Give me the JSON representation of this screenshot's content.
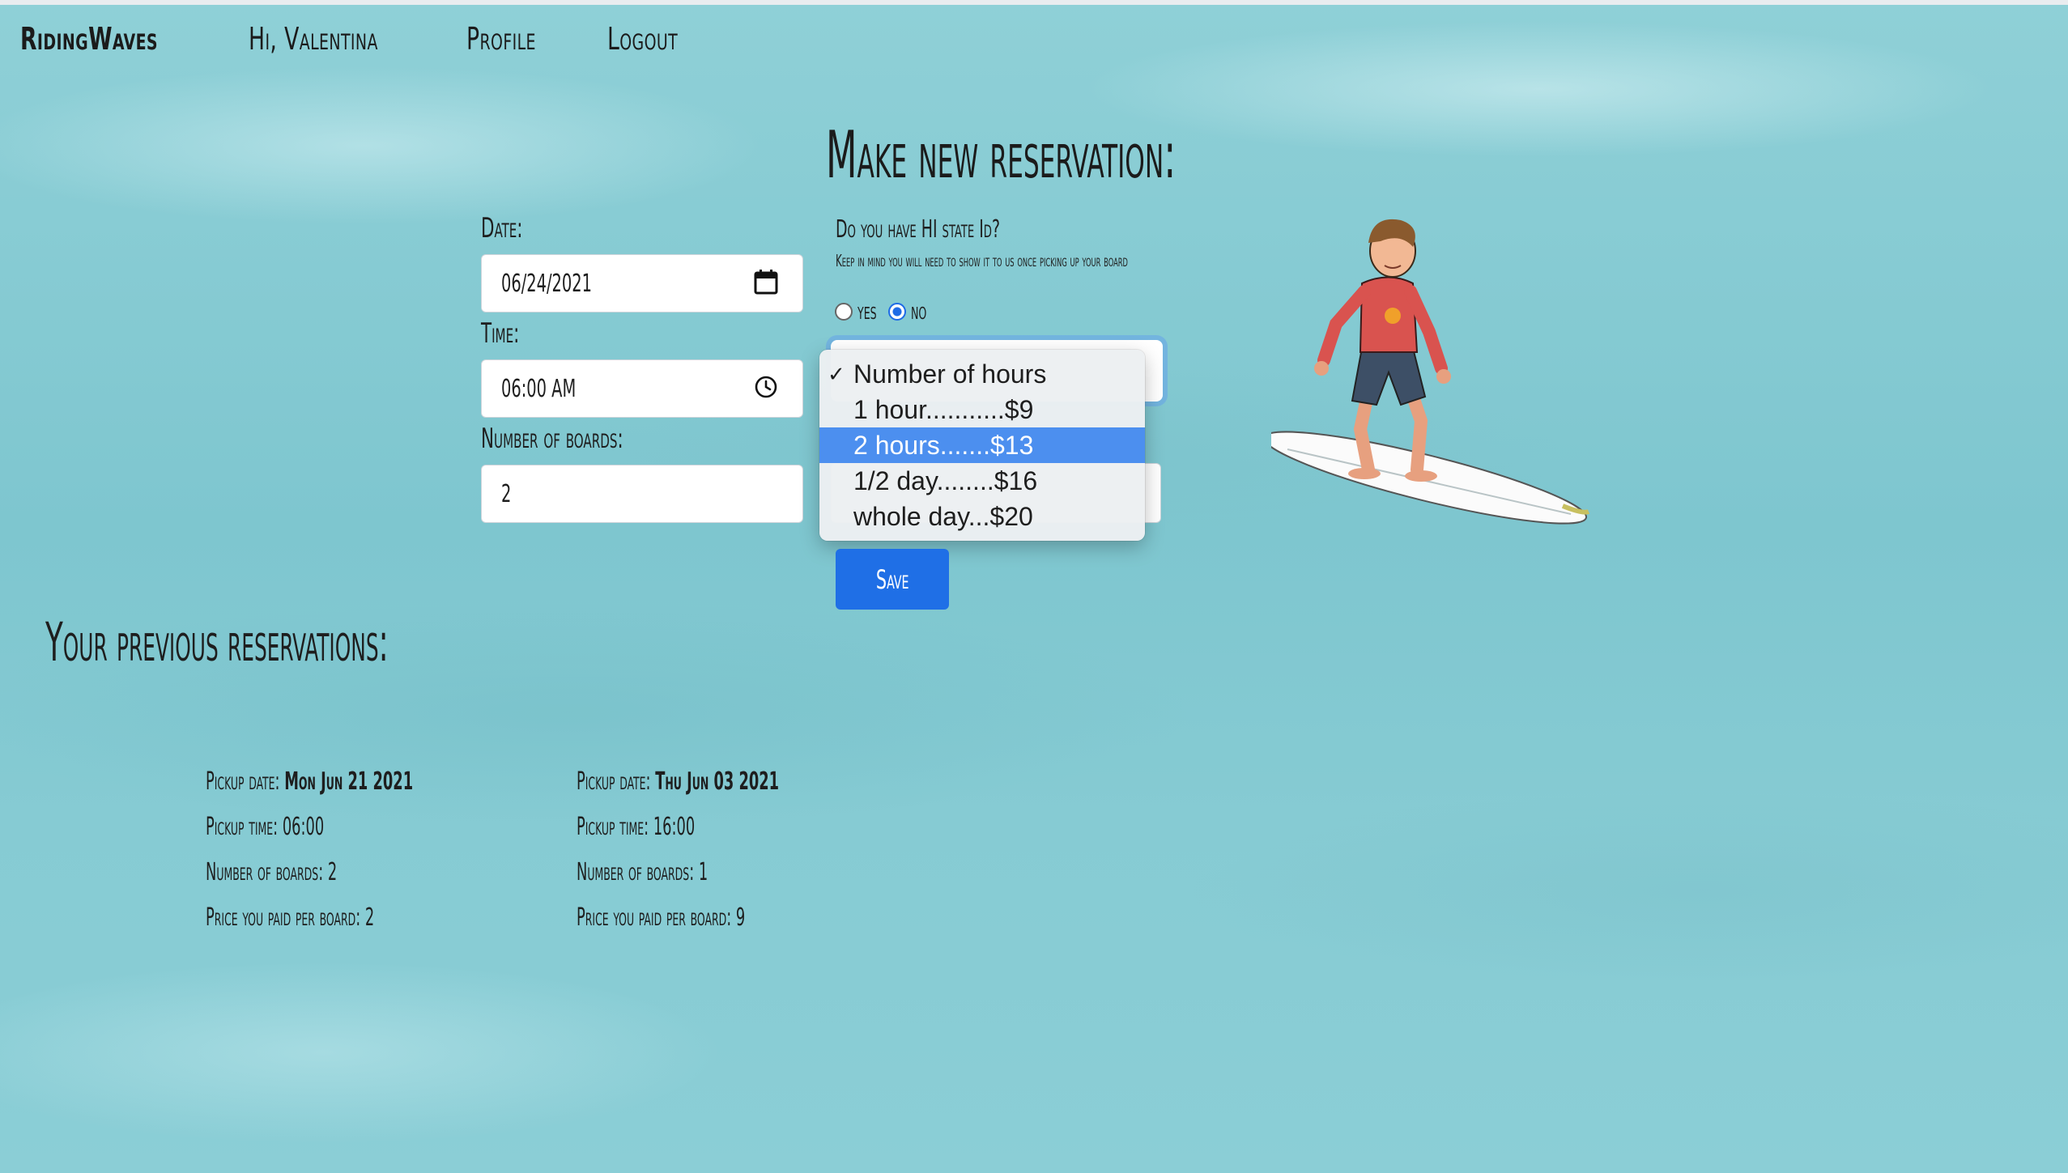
{
  "nav": {
    "brand": "RidingWaves",
    "greeting": "Hi, Valentina",
    "profile": "Profile",
    "logout": "Logout"
  },
  "form": {
    "title": "Make new reservation:",
    "date_label": "Date:",
    "date_value": "06/24/2021",
    "time_label": "Time:",
    "time_value": "06:00 AM",
    "boards_label": "Number of boards:",
    "boards_value": "2",
    "state_id_question": "Do you have HI state Id?",
    "state_id_note": "Keep in mind you will need to show it to us once picking up your board",
    "radio_yes": "yes",
    "radio_no": "no",
    "radio_selected": "no",
    "hours_options": [
      "Number of hours",
      "1 hour...........$9",
      "2 hours.......$13",
      "1/2 day........$16",
      "whole day...$20"
    ],
    "hours_checked": "Number of hours",
    "hours_highlighted": "2 hours.......$13",
    "save_label": "Save"
  },
  "previous": {
    "title": "Your previous reservations:",
    "pickup_date_label": "Pickup date: ",
    "pickup_time_label": "Pickup time: ",
    "boards_label": "Number of boards: ",
    "price_label": "Price you paid per board: ",
    "reservations": [
      {
        "date": "Mon Jun 21 2021",
        "time": "06:00",
        "boards": "2",
        "price": "2"
      },
      {
        "date": "Thu Jun 03 2021",
        "time": "16:00",
        "boards": "1",
        "price": "9"
      }
    ]
  },
  "colors": {
    "primary": "#1f6fe6",
    "highlight": "#4c8fef",
    "background": "#86cbd3"
  },
  "icons": [
    "calendar-icon",
    "clock-icon",
    "checkmark-icon",
    "surfer-illustration"
  ]
}
